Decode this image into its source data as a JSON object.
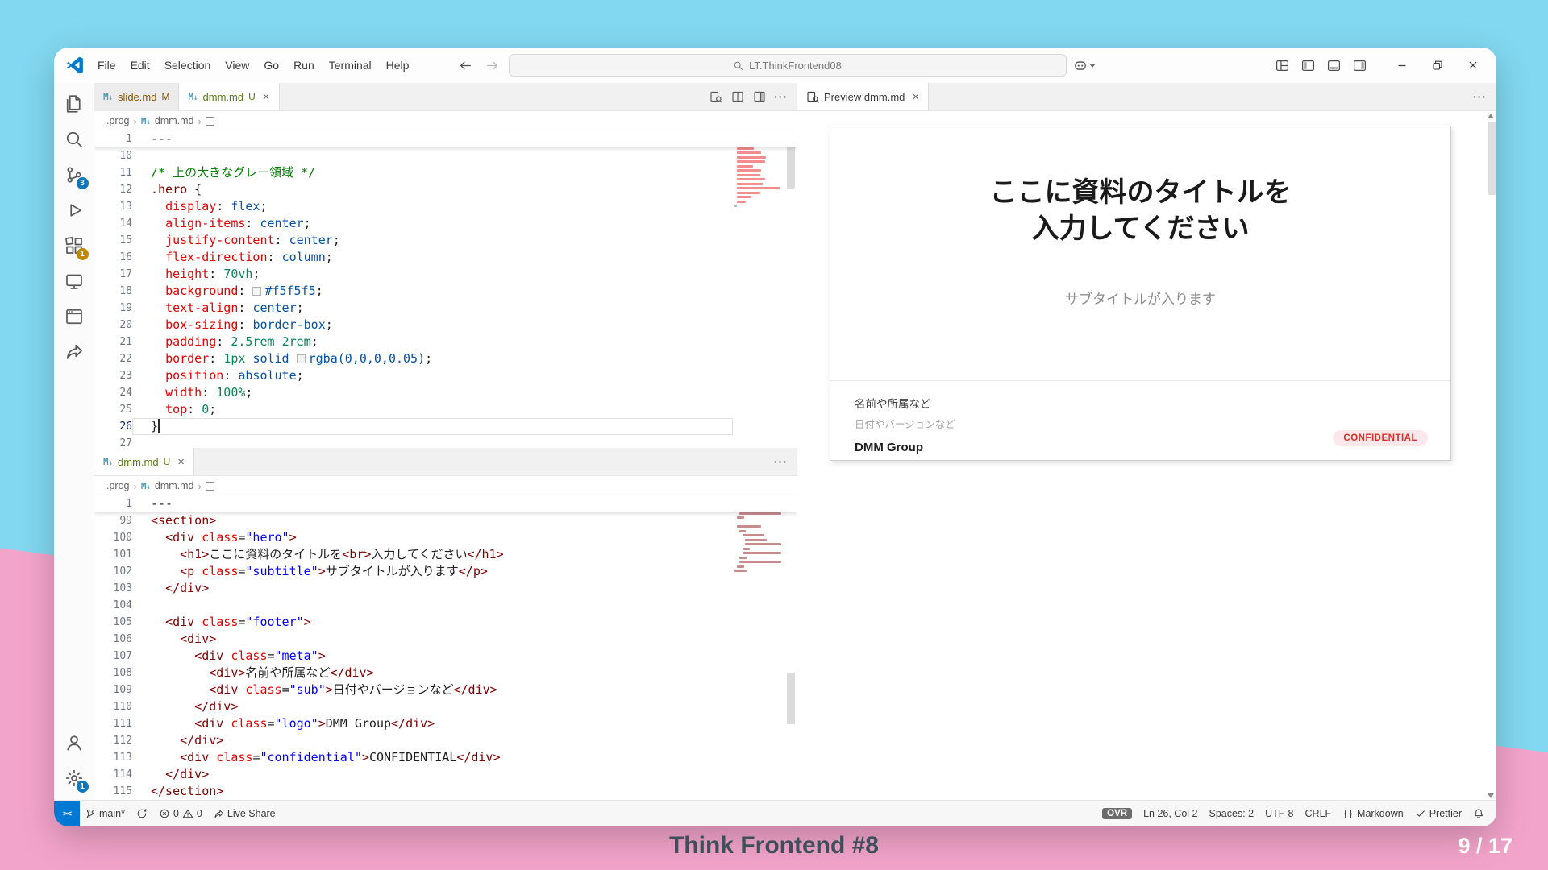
{
  "colors": {
    "backdrop_top": "#82D8F0",
    "backdrop_bottom": "#F3A4CA",
    "accent": "#005FB8",
    "remote_blue": "#0078D4",
    "badge_blue": "#1177bb",
    "badge_amber": "#bf8803",
    "git_modified": "#895503",
    "git_untracked": "#587c0c",
    "confidential_red": "#D93025"
  },
  "titlebar": {
    "menus": [
      "File",
      "Edit",
      "Selection",
      "View",
      "Go",
      "Run",
      "Terminal",
      "Help"
    ],
    "command_center": "LT.ThinkFrontend08"
  },
  "activity_bar": {
    "top": [
      {
        "name": "explorer"
      },
      {
        "name": "search"
      },
      {
        "name": "source-control",
        "badge": "3",
        "badge_color": "blue"
      },
      {
        "name": "run-debug"
      },
      {
        "name": "extensions",
        "badge": "1",
        "badge_color": "amber"
      },
      {
        "name": "remote-explorer"
      },
      {
        "name": "live-preview"
      },
      {
        "name": "live-share"
      }
    ],
    "bottom": [
      {
        "name": "account"
      },
      {
        "name": "settings",
        "badge": "1",
        "badge_color": "blue"
      }
    ]
  },
  "editor_top": {
    "tabs": [
      {
        "label": "slide.md",
        "git": "M",
        "active": false,
        "close": false
      },
      {
        "label": "dmm.md",
        "git": "U",
        "active": true,
        "close": true
      }
    ],
    "actions": [
      "open-preview",
      "split-editor",
      "toggle-layout",
      "more"
    ],
    "breadcrumb": {
      "path": [
        ".prog",
        "dmm.md"
      ]
    },
    "sticky": {
      "n": "1",
      "tokens": [
        [
          "pln",
          "---"
        ]
      ]
    },
    "current_line": "26",
    "lines": [
      [
        "10",
        []
      ],
      [
        "11",
        [
          [
            "cm",
            "/* 上の大きなグレー領域 */"
          ]
        ]
      ],
      [
        "12",
        [
          [
            "sel",
            ".hero"
          ],
          [
            "pln",
            " {"
          ]
        ]
      ],
      [
        "13",
        [
          [
            "pln",
            "  "
          ],
          [
            "prop",
            "display"
          ],
          [
            "pln",
            ": "
          ],
          [
            "val",
            "flex"
          ],
          [
            "pln",
            ";"
          ]
        ]
      ],
      [
        "14",
        [
          [
            "pln",
            "  "
          ],
          [
            "prop",
            "align-items"
          ],
          [
            "pln",
            ": "
          ],
          [
            "val",
            "center"
          ],
          [
            "pln",
            ";"
          ]
        ]
      ],
      [
        "15",
        [
          [
            "pln",
            "  "
          ],
          [
            "prop",
            "justify-content"
          ],
          [
            "pln",
            ": "
          ],
          [
            "val",
            "center"
          ],
          [
            "pln",
            ";"
          ]
        ]
      ],
      [
        "16",
        [
          [
            "pln",
            "  "
          ],
          [
            "prop",
            "flex-direction"
          ],
          [
            "pln",
            ": "
          ],
          [
            "val",
            "column"
          ],
          [
            "pln",
            ";"
          ]
        ]
      ],
      [
        "17",
        [
          [
            "pln",
            "  "
          ],
          [
            "prop",
            "height"
          ],
          [
            "pln",
            ": "
          ],
          [
            "num",
            "70vh"
          ],
          [
            "pln",
            ";"
          ]
        ]
      ],
      [
        "18",
        [
          [
            "pln",
            "  "
          ],
          [
            "prop",
            "background"
          ],
          [
            "pln",
            ": "
          ],
          [
            "sw",
            "#f5f5f5"
          ],
          [
            "val",
            "#f5f5f5"
          ],
          [
            "pln",
            ";"
          ]
        ]
      ],
      [
        "19",
        [
          [
            "pln",
            "  "
          ],
          [
            "prop",
            "text-align"
          ],
          [
            "pln",
            ": "
          ],
          [
            "val",
            "center"
          ],
          [
            "pln",
            ";"
          ]
        ]
      ],
      [
        "20",
        [
          [
            "pln",
            "  "
          ],
          [
            "prop",
            "box-sizing"
          ],
          [
            "pln",
            ": "
          ],
          [
            "val",
            "border-box"
          ],
          [
            "pln",
            ";"
          ]
        ]
      ],
      [
        "21",
        [
          [
            "pln",
            "  "
          ],
          [
            "prop",
            "padding"
          ],
          [
            "pln",
            ": "
          ],
          [
            "num",
            "2.5rem"
          ],
          [
            "pln",
            " "
          ],
          [
            "num",
            "2rem"
          ],
          [
            "pln",
            ";"
          ]
        ]
      ],
      [
        "22",
        [
          [
            "pln",
            "  "
          ],
          [
            "prop",
            "border"
          ],
          [
            "pln",
            ": "
          ],
          [
            "num",
            "1px"
          ],
          [
            "pln",
            " "
          ],
          [
            "val",
            "solid"
          ],
          [
            "pln",
            " "
          ],
          [
            "sw",
            "rgba(0,0,0,0.05)"
          ],
          [
            "val",
            "rgba(0,0,0,0.05)"
          ],
          [
            "pln",
            ";"
          ]
        ]
      ],
      [
        "23",
        [
          [
            "pln",
            "  "
          ],
          [
            "prop",
            "position"
          ],
          [
            "pln",
            ": "
          ],
          [
            "val",
            "absolute"
          ],
          [
            "pln",
            ";"
          ]
        ]
      ],
      [
        "24",
        [
          [
            "pln",
            "  "
          ],
          [
            "prop",
            "width"
          ],
          [
            "pln",
            ": "
          ],
          [
            "num",
            "100%"
          ],
          [
            "pln",
            ";"
          ]
        ]
      ],
      [
        "25",
        [
          [
            "pln",
            "  "
          ],
          [
            "prop",
            "top"
          ],
          [
            "pln",
            ": "
          ],
          [
            "num",
            "0"
          ],
          [
            "pln",
            ";"
          ]
        ]
      ],
      [
        "26",
        [
          [
            "pln",
            "}"
          ]
        ]
      ],
      [
        "27",
        []
      ]
    ]
  },
  "editor_bottom": {
    "tabs": [
      {
        "label": "dmm.md",
        "git": "U",
        "active": true,
        "close": true
      }
    ],
    "actions": [
      "more"
    ],
    "breadcrumb": {
      "path": [
        ".prog",
        "dmm.md"
      ]
    },
    "sticky": {
      "n": "1",
      "tokens": [
        [
          "pln",
          "---"
        ]
      ]
    },
    "current_line": "",
    "lines": [
      [
        "99",
        [
          [
            "sel",
            "<section>"
          ]
        ]
      ],
      [
        "100",
        [
          [
            "pln",
            "  "
          ],
          [
            "sel",
            "<div "
          ],
          [
            "prop",
            "class"
          ],
          [
            "pln",
            "="
          ],
          [
            "str",
            "\"hero\""
          ],
          [
            "sel",
            ">"
          ]
        ]
      ],
      [
        "101",
        [
          [
            "pln",
            "    "
          ],
          [
            "sel",
            "<h1>"
          ],
          [
            "pln",
            "ここに資料のタイトルを"
          ],
          [
            "sel",
            "<br>"
          ],
          [
            "pln",
            "入力してください"
          ],
          [
            "sel",
            "</h1>"
          ]
        ]
      ],
      [
        "102",
        [
          [
            "pln",
            "    "
          ],
          [
            "sel",
            "<p "
          ],
          [
            "prop",
            "class"
          ],
          [
            "pln",
            "="
          ],
          [
            "str",
            "\"subtitle\""
          ],
          [
            "sel",
            ">"
          ],
          [
            "pln",
            "サブタイトルが入ります"
          ],
          [
            "sel",
            "</p>"
          ]
        ]
      ],
      [
        "103",
        [
          [
            "pln",
            "  "
          ],
          [
            "sel",
            "</div>"
          ]
        ]
      ],
      [
        "104",
        []
      ],
      [
        "105",
        [
          [
            "pln",
            "  "
          ],
          [
            "sel",
            "<div "
          ],
          [
            "prop",
            "class"
          ],
          [
            "pln",
            "="
          ],
          [
            "str",
            "\"footer\""
          ],
          [
            "sel",
            ">"
          ]
        ]
      ],
      [
        "106",
        [
          [
            "pln",
            "    "
          ],
          [
            "sel",
            "<div>"
          ]
        ]
      ],
      [
        "107",
        [
          [
            "pln",
            "      "
          ],
          [
            "sel",
            "<div "
          ],
          [
            "prop",
            "class"
          ],
          [
            "pln",
            "="
          ],
          [
            "str",
            "\"meta\""
          ],
          [
            "sel",
            ">"
          ]
        ]
      ],
      [
        "108",
        [
          [
            "pln",
            "        "
          ],
          [
            "sel",
            "<div>"
          ],
          [
            "pln",
            "名前や所属など"
          ],
          [
            "sel",
            "</div>"
          ]
        ]
      ],
      [
        "109",
        [
          [
            "pln",
            "        "
          ],
          [
            "sel",
            "<div "
          ],
          [
            "prop",
            "class"
          ],
          [
            "pln",
            "="
          ],
          [
            "str",
            "\"sub\""
          ],
          [
            "sel",
            ">"
          ],
          [
            "pln",
            "日付やバージョンなど"
          ],
          [
            "sel",
            "</div>"
          ]
        ]
      ],
      [
        "110",
        [
          [
            "pln",
            "      "
          ],
          [
            "sel",
            "</div>"
          ]
        ]
      ],
      [
        "111",
        [
          [
            "pln",
            "      "
          ],
          [
            "sel",
            "<div "
          ],
          [
            "prop",
            "class"
          ],
          [
            "pln",
            "="
          ],
          [
            "str",
            "\"logo\""
          ],
          [
            "sel",
            ">"
          ],
          [
            "pln",
            "DMM Group"
          ],
          [
            "sel",
            "</div>"
          ]
        ]
      ],
      [
        "112",
        [
          [
            "pln",
            "    "
          ],
          [
            "sel",
            "</div>"
          ]
        ]
      ],
      [
        "113",
        [
          [
            "pln",
            "    "
          ],
          [
            "sel",
            "<div "
          ],
          [
            "prop",
            "class"
          ],
          [
            "pln",
            "="
          ],
          [
            "str",
            "\"confidential\""
          ],
          [
            "sel",
            ">"
          ],
          [
            "pln",
            "CONFIDENTIAL"
          ],
          [
            "sel",
            "</div>"
          ]
        ]
      ],
      [
        "114",
        [
          [
            "pln",
            "  "
          ],
          [
            "sel",
            "</div>"
          ]
        ]
      ],
      [
        "115",
        [
          [
            "sel",
            "</section>"
          ]
        ]
      ]
    ]
  },
  "preview": {
    "tabs": [
      {
        "label": "Preview dmm.md",
        "icon": "open-preview",
        "active": true,
        "close": true
      }
    ],
    "actions": [
      "more"
    ],
    "slide": {
      "title": [
        "ここに資料のタイトルを",
        "入力してください"
      ],
      "subtitle": "サブタイトルが入ります",
      "meta_primary": "名前や所属など",
      "meta_secondary": "日付やバージョンなど",
      "brand": "DMM Group",
      "badge": "CONFIDENTIAL"
    }
  },
  "status_bar": {
    "remote": {
      "name": "remote-indicator"
    },
    "left": [
      {
        "name": "git-branch",
        "segments": [
          [
            "icon",
            "branch"
          ],
          [
            "text",
            "main*"
          ]
        ]
      },
      {
        "name": "sync",
        "segments": [
          [
            "icon",
            "sync"
          ]
        ]
      },
      {
        "name": "problems",
        "segments": [
          [
            "icon",
            "error"
          ],
          [
            "text",
            "0"
          ],
          [
            "icon",
            "warning"
          ],
          [
            "text",
            "0"
          ]
        ]
      },
      {
        "name": "live-share",
        "segments": [
          [
            "icon",
            "live-share-sm"
          ],
          [
            "text",
            "Live Share"
          ]
        ]
      }
    ],
    "right": [
      {
        "name": "overtype",
        "style": "ovr",
        "segments": [
          [
            "text",
            "OVR"
          ]
        ]
      },
      {
        "name": "cursor-position",
        "segments": [
          [
            "text",
            "Ln 26, Col 2"
          ]
        ]
      },
      {
        "name": "indentation",
        "segments": [
          [
            "text",
            "Spaces: 2"
          ]
        ]
      },
      {
        "name": "encoding",
        "segments": [
          [
            "text",
            "UTF-8"
          ]
        ]
      },
      {
        "name": "eol",
        "segments": [
          [
            "text",
            "CRLF"
          ]
        ]
      },
      {
        "name": "language-mode",
        "segments": [
          [
            "icon",
            "braces"
          ],
          [
            "text",
            "Markdown"
          ]
        ]
      },
      {
        "name": "formatter",
        "segments": [
          [
            "icon",
            "check"
          ],
          [
            "text",
            "Prettier"
          ]
        ]
      },
      {
        "name": "notifications",
        "segments": [
          [
            "icon",
            "bell"
          ]
        ]
      }
    ]
  },
  "caption": {
    "title": "Think Frontend #8",
    "page": "9 / 17"
  }
}
